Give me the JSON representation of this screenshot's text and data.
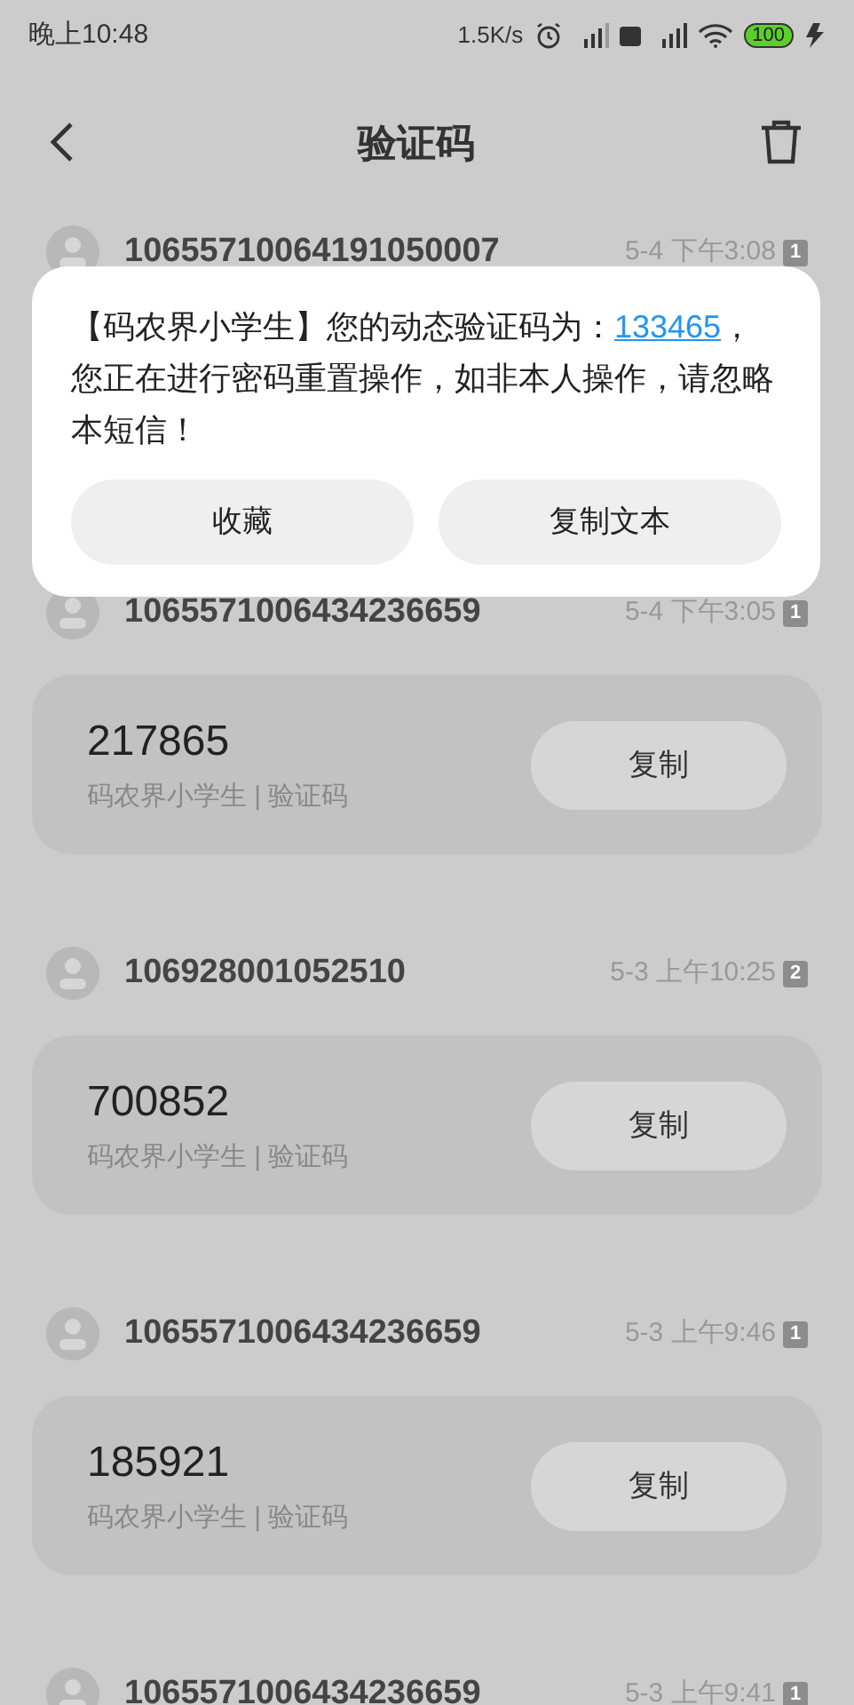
{
  "status_bar": {
    "time": "晚上10:48",
    "net_speed": "1.5K/s",
    "battery": "100",
    "charging": true
  },
  "header": {
    "title": "验证码"
  },
  "messages": [
    {
      "sender": "10655710064191050007",
      "time": "5-4 下午3:08",
      "count": "1"
    },
    {
      "sender": "1065571006434236659",
      "time": "5-4 下午3:05",
      "count": "1",
      "code": "217865",
      "source": "码农界小学生 | 验证码",
      "copy": "复制"
    },
    {
      "sender": "106928001052510",
      "time": "5-3 上午10:25",
      "count": "2",
      "code": "700852",
      "source": "码农界小学生 | 验证码",
      "copy": "复制"
    },
    {
      "sender": "1065571006434236659",
      "time": "5-3 上午9:46",
      "count": "1",
      "code": "185921",
      "source": "码农界小学生 | 验证码",
      "copy": "复制"
    },
    {
      "sender": "1065571006434236659",
      "time": "5-3 上午9:41",
      "count": "1"
    }
  ],
  "dialog": {
    "text_before": "【码农界小学生】您的动态验证码为：",
    "code_link": "133465",
    "text_after": "，您正在进行密码重置操作，如非本人操作，请忽略本短信！",
    "buttons": [
      "收藏",
      "复制文本"
    ]
  }
}
